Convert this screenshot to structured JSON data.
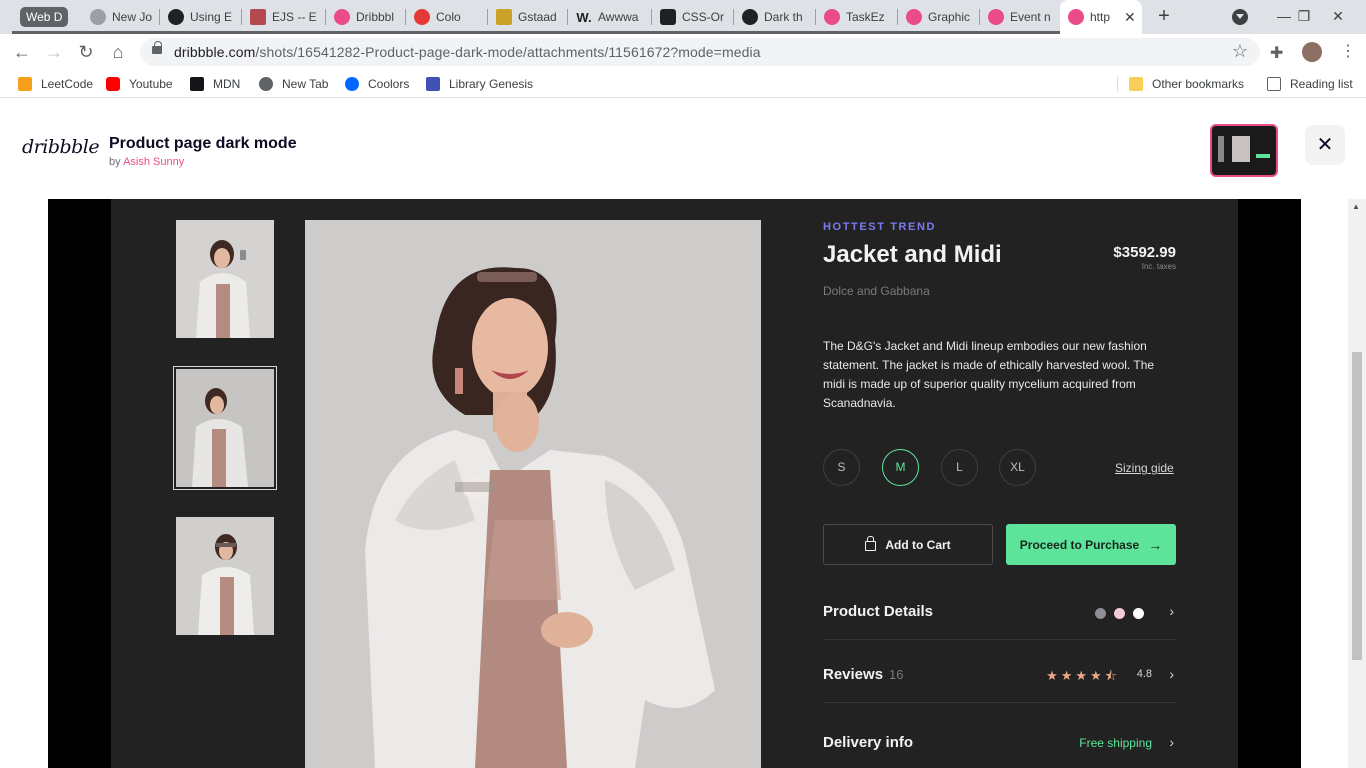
{
  "browser": {
    "group_label": "Web D",
    "tabs": [
      {
        "title": "New Jo",
        "color": "#9aa0a6"
      },
      {
        "title": "Using E",
        "color": "#202124"
      },
      {
        "title": "EJS -- E",
        "color": "#b4494f"
      },
      {
        "title": "Dribbbl",
        "color": "#ea4c89"
      },
      {
        "title": "Colo",
        "color": "#e53935"
      },
      {
        "title": "Gstaad",
        "color": "#c9a227"
      },
      {
        "title": "Awwwa",
        "color": "#202124"
      },
      {
        "title": "CSS-Or",
        "color": "#202124"
      },
      {
        "title": "Dark th",
        "color": "#202124"
      },
      {
        "title": "TaskEz",
        "color": "#ea4c89"
      },
      {
        "title": "Graphic",
        "color": "#ea4c89"
      },
      {
        "title": "Event n",
        "color": "#ea4c89"
      },
      {
        "title": "http",
        "color": "#ea4c89"
      }
    ],
    "new_tab": "+",
    "window_controls": {
      "minimize": "—",
      "restore": "❐",
      "close": "✕"
    },
    "url_host": "dribbble.com",
    "url_path": "/shots/16541282-Product-page-dark-mode/attachments/11561672?mode=media",
    "bookmarks": [
      {
        "label": "LeetCode",
        "color": "#f89f1b"
      },
      {
        "label": "Youtube",
        "color": "#ff0000"
      },
      {
        "label": "MDN",
        "color": "#15141a"
      },
      {
        "label": "New Tab",
        "color": "#5f6368"
      },
      {
        "label": "Coolors",
        "color": "#0066ff"
      },
      {
        "label": "Library Genesis",
        "color": "#3f51b5"
      }
    ],
    "other_bookmarks": "Other bookmarks",
    "reading_list": "Reading list"
  },
  "shot": {
    "logo": "dribbble",
    "title": "Product page dark mode",
    "by_prefix": "by",
    "author": "Asish Sunny",
    "close_icon": "✕"
  },
  "product": {
    "kicker": "HOTTEST TREND",
    "title": "Jacket and Midi",
    "price": "$3592.99",
    "price_note": "Inc. taxes",
    "brand": "Dolce and Gabbana",
    "description": "The D&G's Jacket and Midi lineup embodies our new fashion statement. The jacket is made of ethically harvested wool. The midi is made up of superior quality mycelium acquired from Scanadnavia.",
    "sizes": [
      "S",
      "M",
      "L",
      "XL"
    ],
    "selected_size": "M",
    "sizing_guide": "Sizing gide",
    "add_to_cart": "Add to Cart",
    "proceed": "Proceed to Purchase",
    "arrow": "→",
    "details_label": "Product Details",
    "color_options": [
      "#8f8d96",
      "#f3c9d9",
      "#ffffff"
    ],
    "reviews_label": "Reviews",
    "reviews_count": "16",
    "stars": "★★★★⯪",
    "rating": "4.8",
    "delivery_label": "Delivery info",
    "delivery_value": "Free shipping",
    "chevron": "›"
  },
  "colors": {
    "accent_green": "#5ee49a",
    "accent_purple": "#7b7bf2",
    "dribbble_pink": "#ea4c89",
    "panel_bg": "#222222"
  }
}
